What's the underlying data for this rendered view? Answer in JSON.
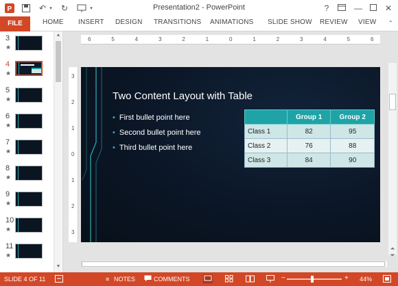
{
  "window": {
    "title": "Presentation2 - PowerPoint",
    "help_label": "?"
  },
  "ribbon": {
    "file": "FILE",
    "tabs": [
      "HOME",
      "INSERT",
      "DESIGN",
      "TRANSITIONS",
      "ANIMATIONS",
      "SLIDE SHOW",
      "REVIEW",
      "VIEW"
    ]
  },
  "thumbnails": {
    "items": [
      {
        "number": "3",
        "active": false
      },
      {
        "number": "4",
        "active": true
      },
      {
        "number": "5",
        "active": false
      },
      {
        "number": "6",
        "active": false
      },
      {
        "number": "7",
        "active": false
      },
      {
        "number": "8",
        "active": false
      },
      {
        "number": "9",
        "active": false
      },
      {
        "number": "10",
        "active": false
      },
      {
        "number": "11",
        "active": false
      }
    ],
    "star": "★"
  },
  "rulers": {
    "horizontal": [
      "6",
      "5",
      "4",
      "3",
      "2",
      "1",
      "0",
      "1",
      "2",
      "3",
      "4",
      "5",
      "6"
    ],
    "vertical": [
      "3",
      "2",
      "1",
      "0",
      "1",
      "2",
      "3"
    ]
  },
  "slide": {
    "title": "Two Content Layout with Table",
    "bullets": [
      "First bullet point here",
      "Second bullet point here",
      "Third bullet point here"
    ],
    "table": {
      "headers": [
        "",
        "Group 1",
        "Group 2"
      ],
      "rows": [
        [
          "Class 1",
          "82",
          "95"
        ],
        [
          "Class 2",
          "76",
          "88"
        ],
        [
          "Class 3",
          "84",
          "90"
        ]
      ]
    }
  },
  "status": {
    "slide_indicator": "SLIDE 4 OF 11",
    "notes": "NOTES",
    "comments": "COMMENTS",
    "zoom": "44%",
    "zoom_level": 0.44
  },
  "colors": {
    "accent": "#d24726",
    "table_header": "#1ea3a6",
    "slide_bg": "#0c1827"
  }
}
